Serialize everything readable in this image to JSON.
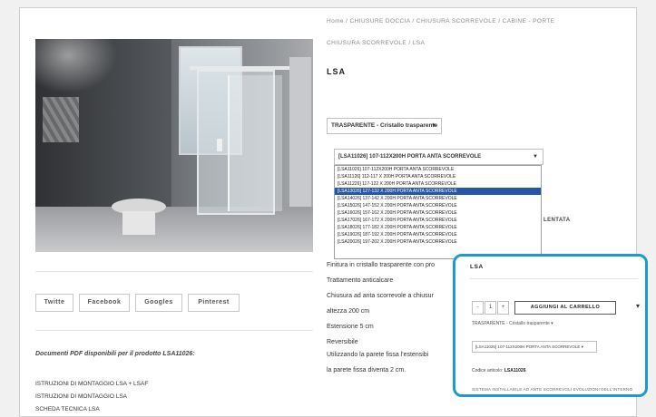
{
  "breadcrumb": {
    "line1": "Home / CHIUSURE DOCCIA / CHIUSURA SCORREVOLE / CABINE - PORTE",
    "line2": "CHIUSURA SCORREVOLE / LSA"
  },
  "product": {
    "title": "LSA"
  },
  "finish_select": {
    "value": "TRASPARENTE - Cristallo trasparente",
    "caret": "▼"
  },
  "size_select": {
    "value": "[LSA11026] 107-112X200H PORTA ANTA SCORREVOLE",
    "caret": "▼",
    "options": [
      "[LSA11026] 107-112X200H PORTA ANTA SCORREVOLE",
      "[LSA11126] 112-117 X 200H PORTA ANTA SCORREVOLE",
      "[LSA11226] 117-122 X 200H PORTA ANTA SCORREVOLE",
      "[LSA13026] 127-132 X 200H PORTA ANTA SCORREVOLE",
      "[LSA14026] 137-142 X 200H PORTA ANTA SCORREVOLE",
      "[LSA15026] 147-152 X 200H PORTA ANTA SCORREVOLE",
      "[LSA16026] 157-162 X 200H PORTA ANTA SCORREVOLE",
      "[LSA17026] 167-172 X 200H PORTA ANTA SCORREVOLE",
      "[LSA18026] 177-182 X 200H PORTA ANTA SCORREVOLE",
      "[LSA19026] 187-192 X 200H PORTA ANTA SCORREVOLE",
      "[LSA20026] 197-202 X 200H PORTA ANTA SCORREVOLE"
    ],
    "selected_index": 3
  },
  "obscured_text": "LENTATA",
  "description": [
    "Finitura in cristallo trasparente con pro",
    "Trattamento anticalcare",
    "Chiusura ad anta scorrevole a chiusur",
    "altezza 200 cm",
    "Estensione 5 cm",
    "Reversibile",
    "Utilizzando la parete fissa l'estensibi",
    "la parete fissa diventa 2 cm."
  ],
  "share": {
    "twitter": "Twitte",
    "facebook": "Facebook",
    "google": "Googles",
    "pinterest": "Pinterest"
  },
  "documents": {
    "note": "Documenti PDF disponibili per il prodotto LSA11026:",
    "links": [
      "ISTRUZIONI DI MONTAGGIO LSA + LSAF",
      "ISTRUZIONI DI MONTAGGIO LSA",
      "SCHEDA TECNICA LSA"
    ]
  },
  "zoom": {
    "title": "LSA",
    "qty_minus": "-",
    "qty_value": "1",
    "qty_plus": "+",
    "cart_label": "AGGIUNGI AL CARRELLO",
    "chevron": "▾",
    "finish_value": "TRASPARENTE - Cristallo trasparente ▾",
    "size_value": "[LSA11026] 107-112X200H PORTA ANTA SCORREVOLE ▾",
    "code_label": "Codice articolo:",
    "code_value": "LSA11026",
    "note": "SISTEMA INSTALLABILE AD ANTE SCORREVOLI EVOLUZIONI DELL'INTERNO"
  },
  "colors": {
    "accent": "#1f9ac8",
    "selected_option": "#2457a6"
  }
}
